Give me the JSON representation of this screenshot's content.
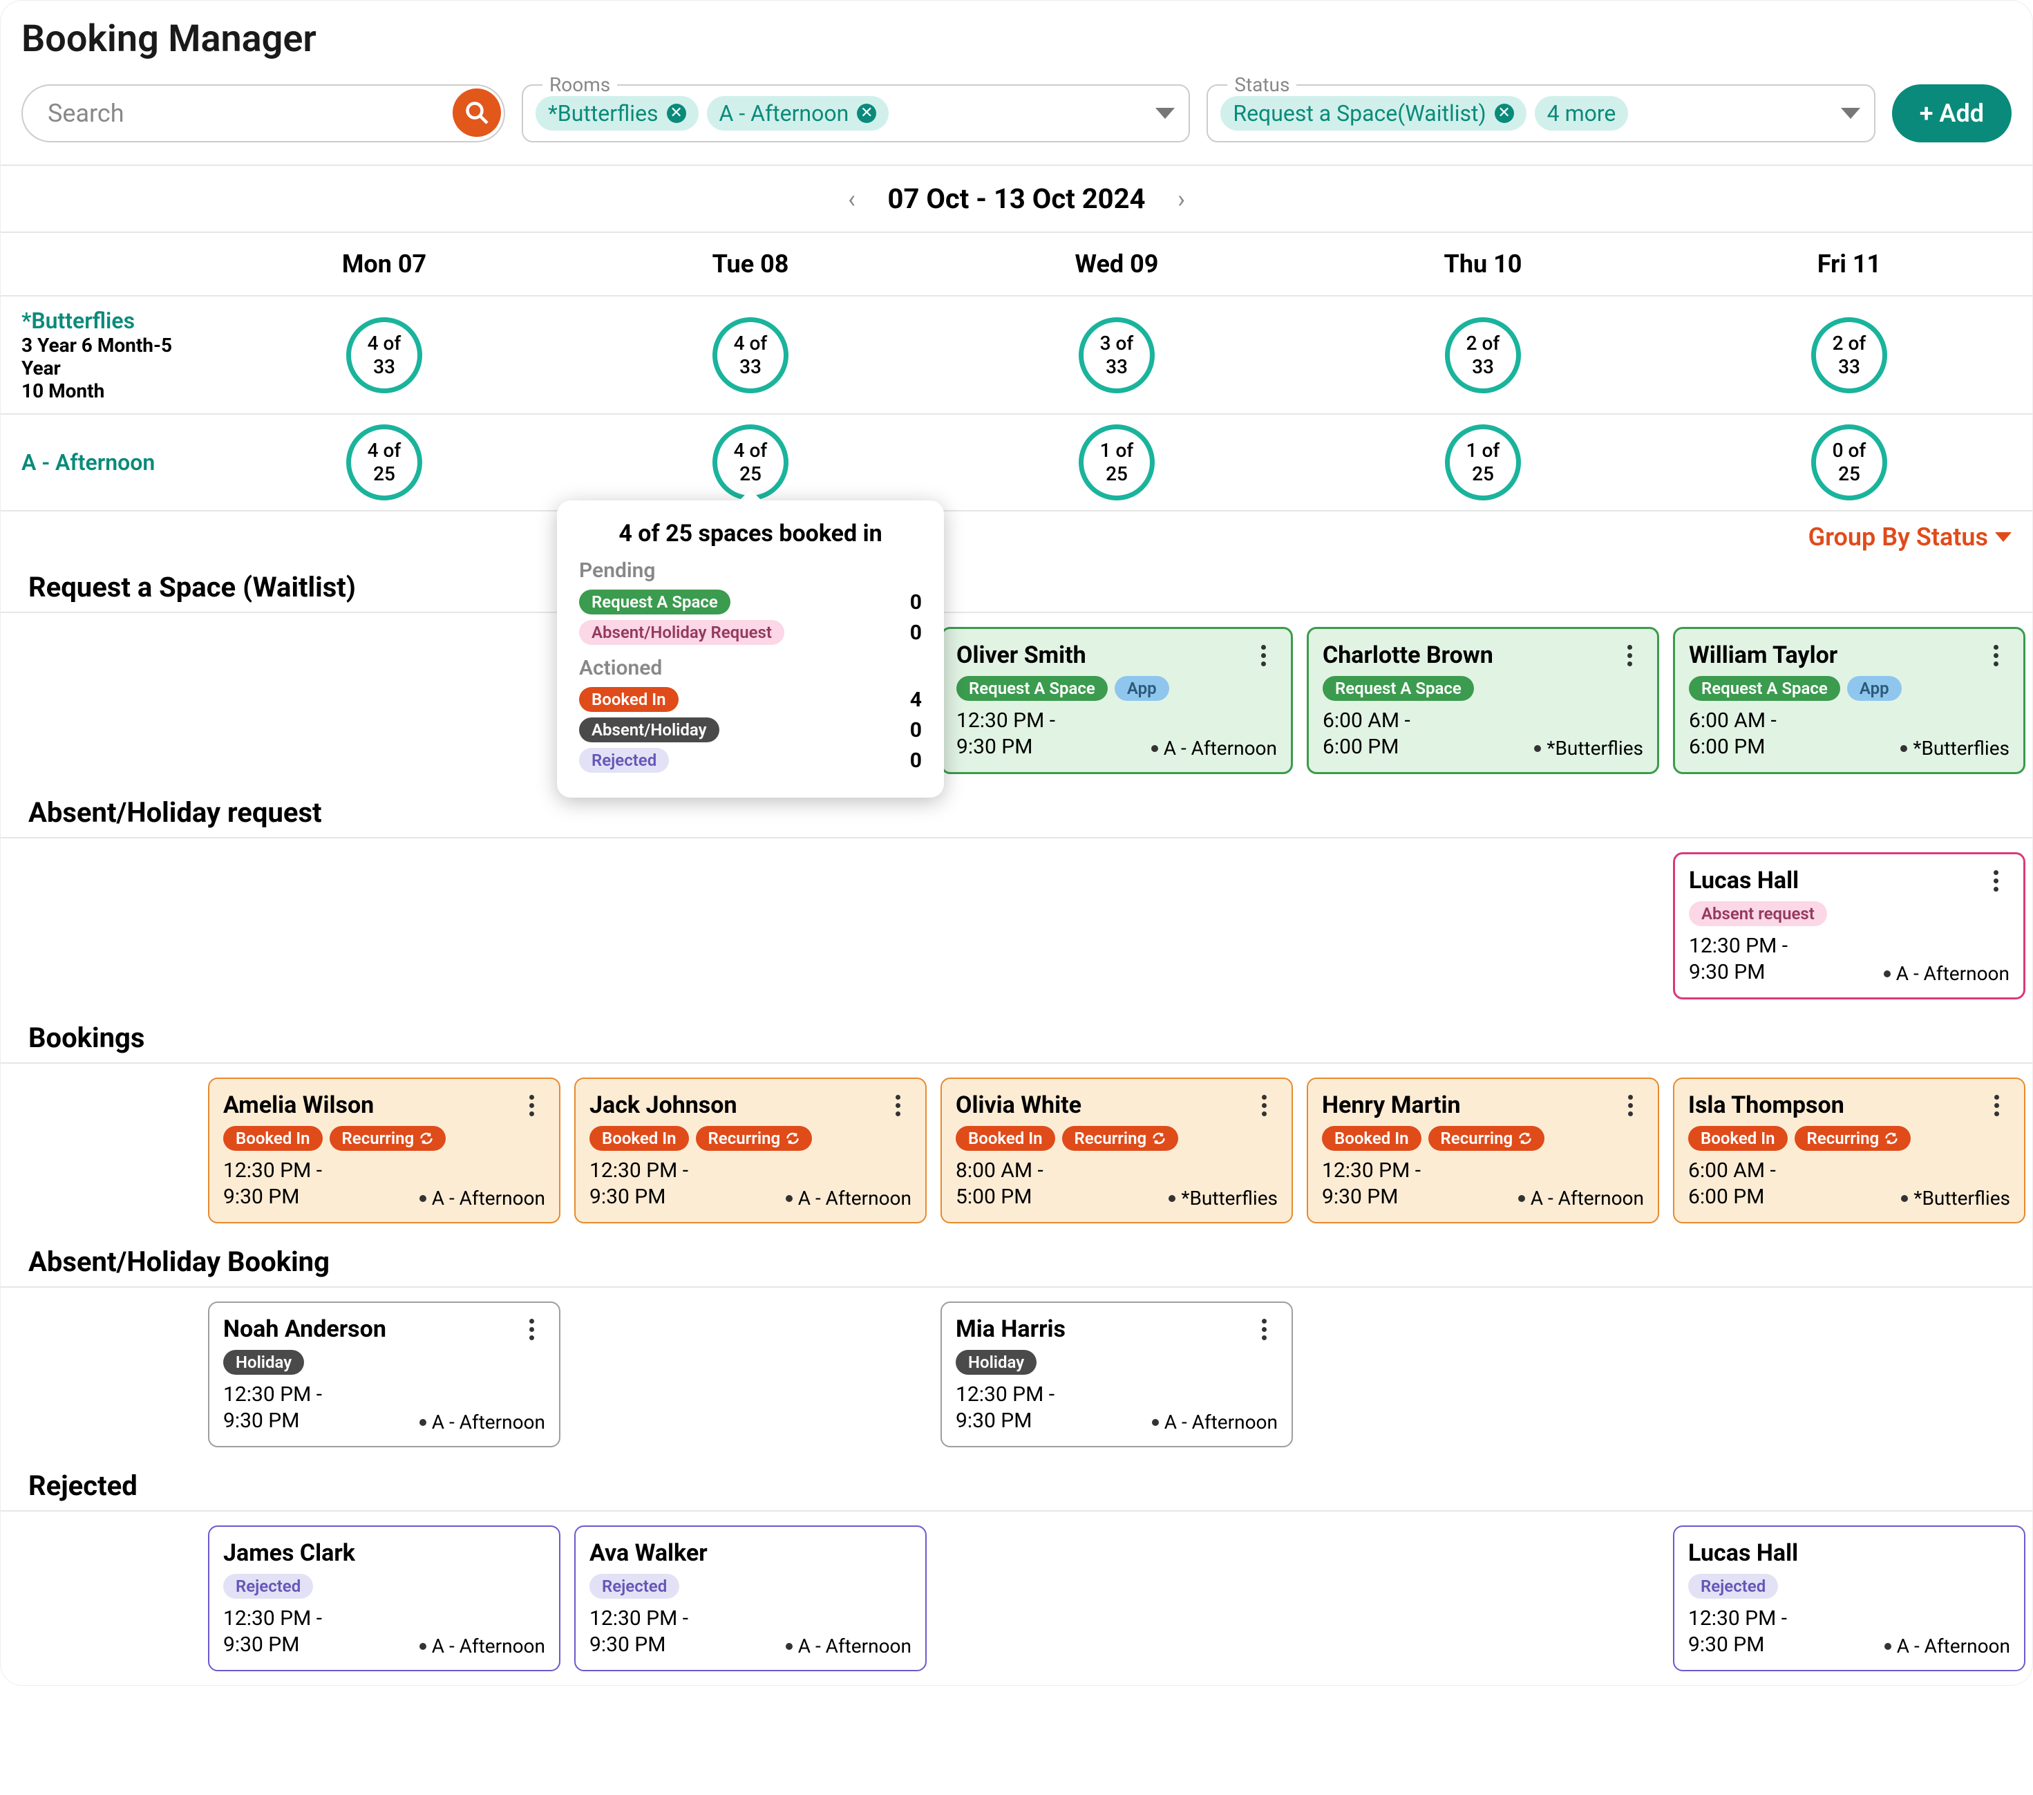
{
  "title": "Booking Manager",
  "search": {
    "placeholder": "Search"
  },
  "rooms_filter": {
    "label": "Rooms",
    "chips": [
      "*Butterflies",
      "A - Afternoon"
    ]
  },
  "status_filter": {
    "label": "Status",
    "chips": [
      "Request a Space(Waitlist)"
    ],
    "extra": "4 more"
  },
  "add_label": "+ Add",
  "week": {
    "label": "07 Oct - 13 Oct 2024"
  },
  "days": [
    "Mon 07",
    "Tue 08",
    "Wed 09",
    "Thu 10",
    "Fri 11"
  ],
  "rooms": {
    "r0": {
      "name": "*Butterflies",
      "sub1": "3 Year 6 Month-5 Year",
      "sub2": "10 Month",
      "caps": [
        {
          "n": "4 of",
          "d": "33"
        },
        {
          "n": "4 of",
          "d": "33"
        },
        {
          "n": "3 of",
          "d": "33"
        },
        {
          "n": "2 of",
          "d": "33"
        },
        {
          "n": "2 of",
          "d": "33"
        }
      ]
    },
    "r1": {
      "name": "A - Afternoon",
      "caps": [
        {
          "n": "4 of",
          "d": "25"
        },
        {
          "n": "4 of",
          "d": "25"
        },
        {
          "n": "1 of",
          "d": "25"
        },
        {
          "n": "1 of",
          "d": "25"
        },
        {
          "n": "0 of",
          "d": "25"
        }
      ]
    }
  },
  "popover": {
    "title": "4 of 25 spaces booked in",
    "pending": "Pending",
    "actioned": "Actioned",
    "rows": {
      "ras": {
        "label": "Request A Space",
        "count": "0"
      },
      "ahr": {
        "label": "Absent/Holiday Request",
        "count": "0"
      },
      "booked": {
        "label": "Booked In",
        "count": "4"
      },
      "ah": {
        "label": "Absent/Holiday",
        "count": "0"
      },
      "rej": {
        "label": "Rejected",
        "count": "0"
      }
    }
  },
  "group_by": "Group By Status",
  "groups": {
    "request": "Request a Space (Waitlist)",
    "absent_req": "Absent/Holiday request",
    "bookings": "Bookings",
    "absent_book": "Absent/Holiday Booking",
    "rejected": "Rejected"
  },
  "pills": {
    "request_a_space": "Request A Space",
    "app": "App",
    "absent_request": "Absent request",
    "booked_in": "Booked In",
    "recurring": "Recurring",
    "holiday": "Holiday",
    "rejected": "Rejected"
  },
  "rooms_text": {
    "afternoon": "A - Afternoon",
    "butterflies": "*Butterflies"
  },
  "cards": {
    "oliver": {
      "name": "Oliver Smith",
      "time1": "12:30 PM -",
      "time2": "9:30 PM"
    },
    "charlotte": {
      "name": "Charlotte Brown",
      "time1": "6:00 AM -",
      "time2": "6:00 PM"
    },
    "william": {
      "name": "William Taylor",
      "time1": "6:00 AM -",
      "time2": "6:00 PM"
    },
    "lucas": {
      "name": "Lucas Hall",
      "time1": "12:30 PM -",
      "time2": "9:30 PM"
    },
    "amelia": {
      "name": "Amelia Wilson",
      "time1": "12:30 PM -",
      "time2": "9:30 PM"
    },
    "jack": {
      "name": "Jack Johnson",
      "time1": "12:30 PM -",
      "time2": "9:30 PM"
    },
    "olivia": {
      "name": "Olivia White",
      "time1": "8:00 AM -",
      "time2": "5:00 PM"
    },
    "henry": {
      "name": "Henry Martin",
      "time1": "12:30 PM -",
      "time2": "9:30 PM"
    },
    "isla": {
      "name": "Isla Thompson",
      "time1": "6:00 AM -",
      "time2": "6:00 PM"
    },
    "noah": {
      "name": "Noah Anderson",
      "time1": "12:30 PM -",
      "time2": "9:30 PM"
    },
    "mia": {
      "name": "Mia Harris",
      "time1": "12:30 PM -",
      "time2": "9:30 PM"
    },
    "james": {
      "name": "James Clark",
      "time1": "12:30 PM -",
      "time2": "9:30 PM"
    },
    "ava": {
      "name": "Ava Walker",
      "time1": "12:30 PM -",
      "time2": "9:30 PM"
    },
    "lucas2": {
      "name": "Lucas Hall",
      "time1": "12:30 PM -",
      "time2": "9:30 PM"
    }
  }
}
